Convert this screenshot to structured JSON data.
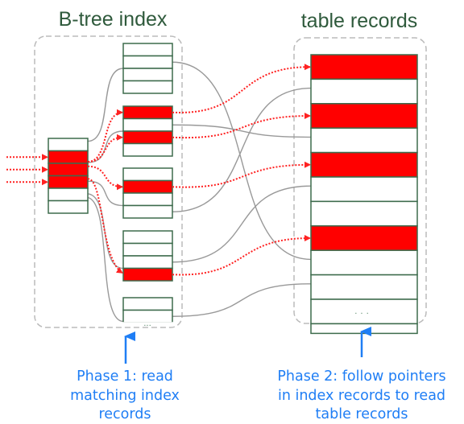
{
  "titles": {
    "index": "B-tree index",
    "table": "table records"
  },
  "annotations": {
    "phase1": [
      "Phase 1: read",
      "matching index",
      "records"
    ],
    "phase2": [
      "Phase 2: follow pointers",
      "in index records to read",
      "table records"
    ]
  },
  "ellipsis": "...",
  "colors": {
    "record_border": "#3d6b4c",
    "highlight": "#ff0000",
    "pointer_line": "#999999",
    "matching_arrow": "#ff2222",
    "container_border": "#bbbbbb",
    "title": "#2f5a3c",
    "annotation": "#1f7ef5"
  },
  "index": {
    "root": {
      "rows": 6,
      "highlighted_rows": [
        1,
        2,
        3
      ]
    },
    "leaves": [
      {
        "rows": 4,
        "highlighted_rows": []
      },
      {
        "rows": 4,
        "highlighted_rows": [
          0,
          2
        ]
      },
      {
        "rows": 4,
        "highlighted_rows": [
          1
        ]
      },
      {
        "rows": 4,
        "highlighted_rows": [
          3
        ]
      },
      {
        "rows": 2,
        "highlighted_rows": [],
        "truncated": true
      }
    ]
  },
  "table": {
    "rows": 11,
    "highlighted_rows": [
      0,
      2,
      4,
      7
    ],
    "truncated": true
  },
  "matching_pointers": [
    {
      "from_leaf": 1,
      "from_row": 0,
      "to_table_row": 0
    },
    {
      "from_leaf": 1,
      "from_row": 2,
      "to_table_row": 2
    },
    {
      "from_leaf": 2,
      "from_row": 1,
      "to_table_row": 4
    },
    {
      "from_leaf": 3,
      "from_row": 3,
      "to_table_row": 7
    }
  ],
  "other_pointers": [
    {
      "from_leaf": 0,
      "from_row": 1,
      "to_table_row": 8
    },
    {
      "from_leaf": 1,
      "from_row": 1,
      "to_table_row": 3
    },
    {
      "from_leaf": 2,
      "from_row": 3,
      "to_table_row": 1
    },
    {
      "from_leaf": 3,
      "from_row": 2,
      "to_table_row": 5
    },
    {
      "from_leaf": 4,
      "from_row": 1,
      "to_table_row": 9
    }
  ],
  "incoming_arrows": 3
}
